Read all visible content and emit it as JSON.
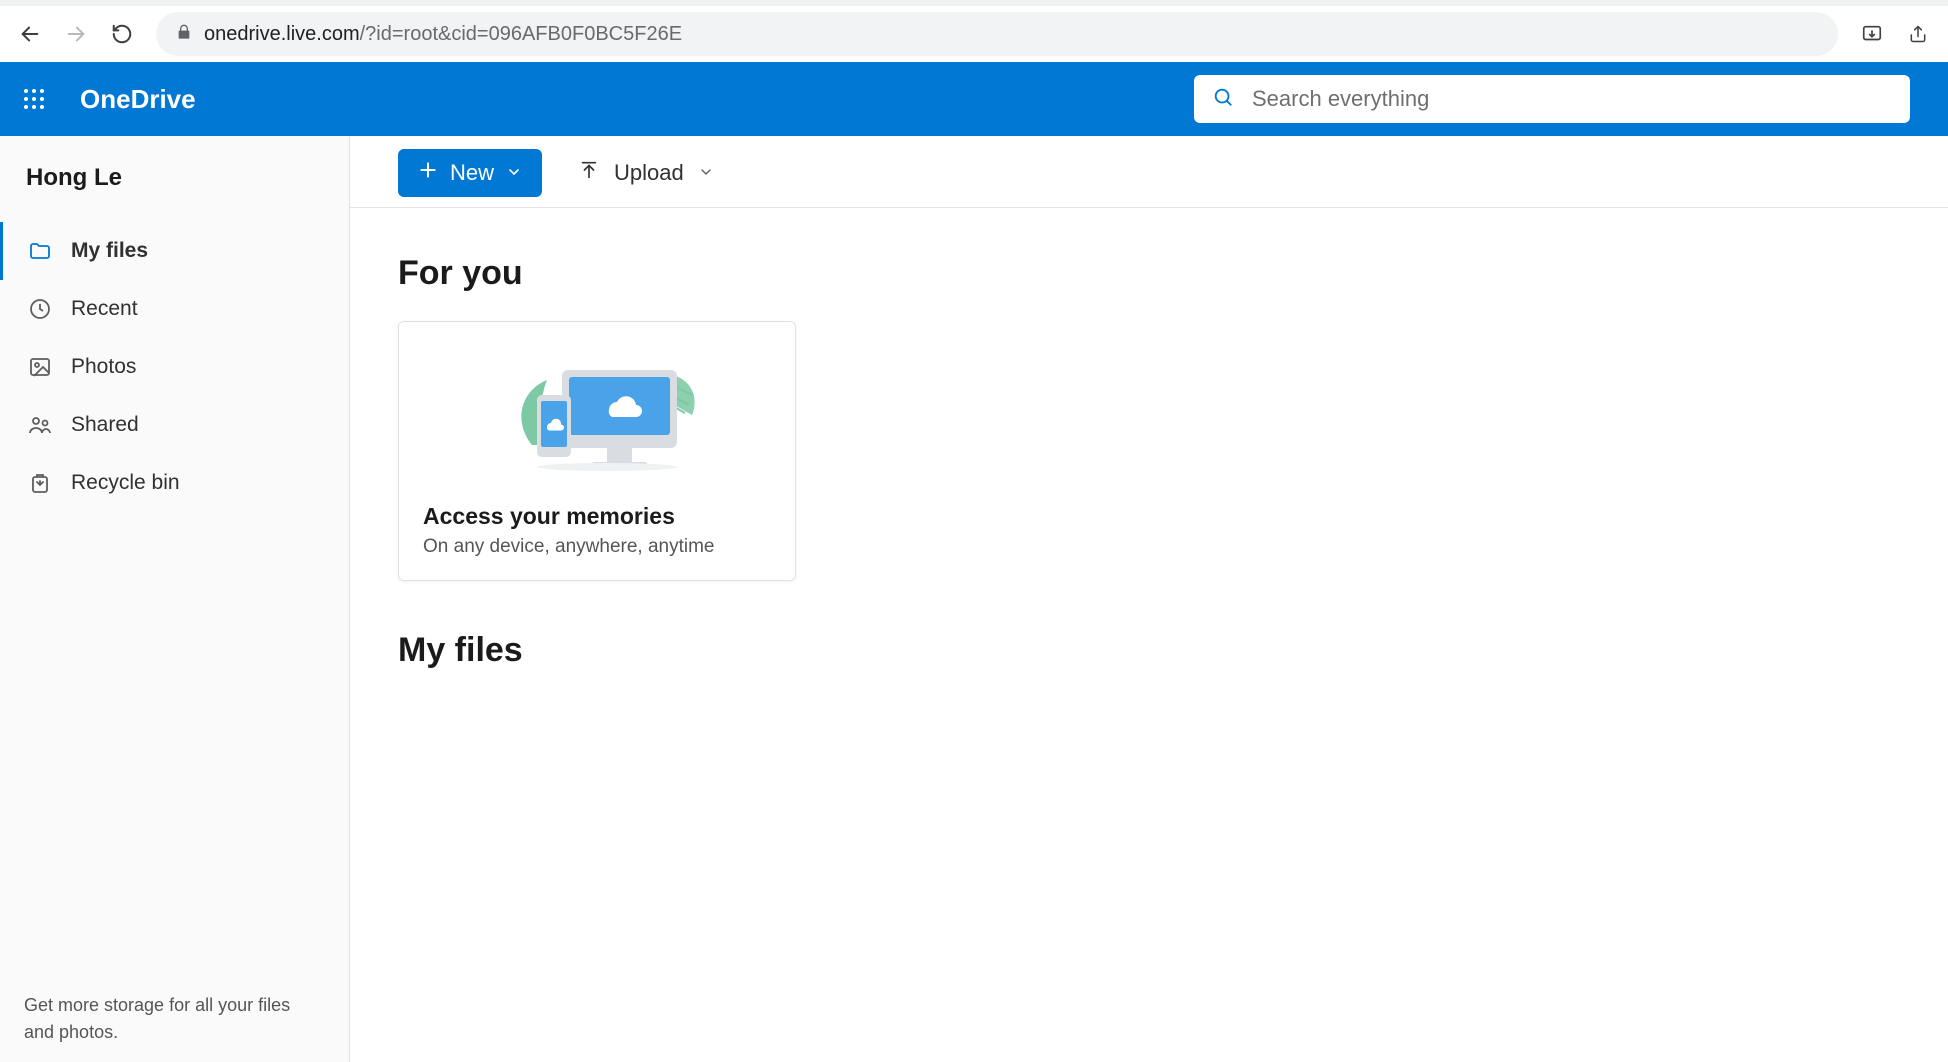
{
  "browser": {
    "url_host": "onedrive.live.com",
    "url_rest": "/?id=root&cid=096AFB0F0BC5F26E"
  },
  "header": {
    "app_name": "OneDrive",
    "search_placeholder": "Search everything"
  },
  "sidebar": {
    "user": "Hong Le",
    "items": [
      {
        "label": "My files"
      },
      {
        "label": "Recent"
      },
      {
        "label": "Photos"
      },
      {
        "label": "Shared"
      },
      {
        "label": "Recycle bin"
      }
    ],
    "footer": "Get more storage for all your files and photos."
  },
  "toolbar": {
    "new_label": "New",
    "upload_label": "Upload"
  },
  "main": {
    "for_you_heading": "For you",
    "card_title": "Access your memories",
    "card_sub": "On any device, anywhere, anytime",
    "my_files_heading": "My files"
  }
}
